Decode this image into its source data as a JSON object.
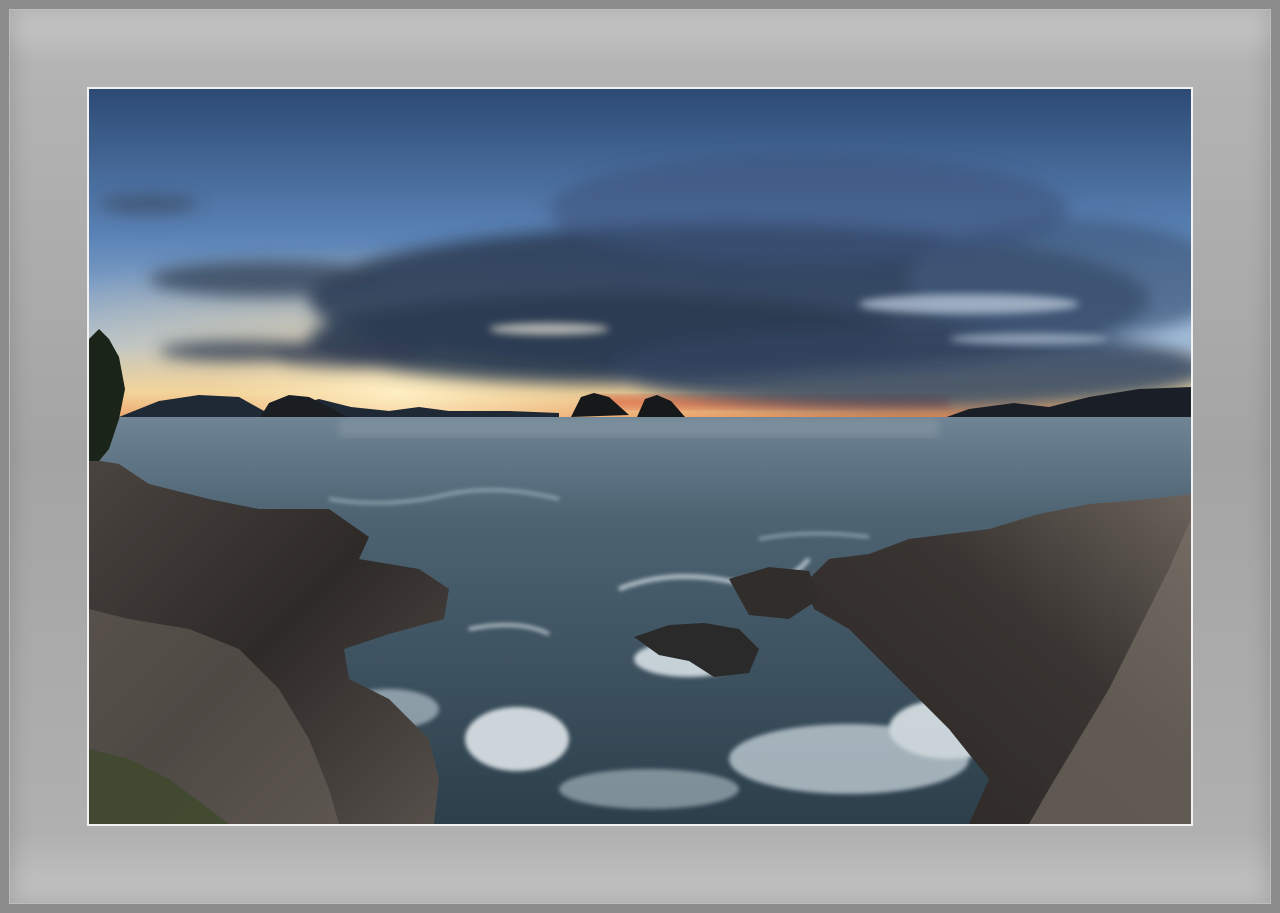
{
  "frame": {
    "outer_color": "#8c8c8c",
    "mat_color": "#a8a8a8",
    "inner_line_color": "#f2f2f2"
  },
  "photo": {
    "subject": "coastal-seascape-at-dusk",
    "colors": {
      "sky_top": "#2e4d78",
      "sky_mid": "#5f86b8",
      "horizon_glow": "#f0c070",
      "sunset_red": "#e0603a",
      "cloud_dark": "#2f3f58",
      "sea": "#3e5566",
      "rock": "#3a3634",
      "surf": "#e6eef2"
    }
  }
}
